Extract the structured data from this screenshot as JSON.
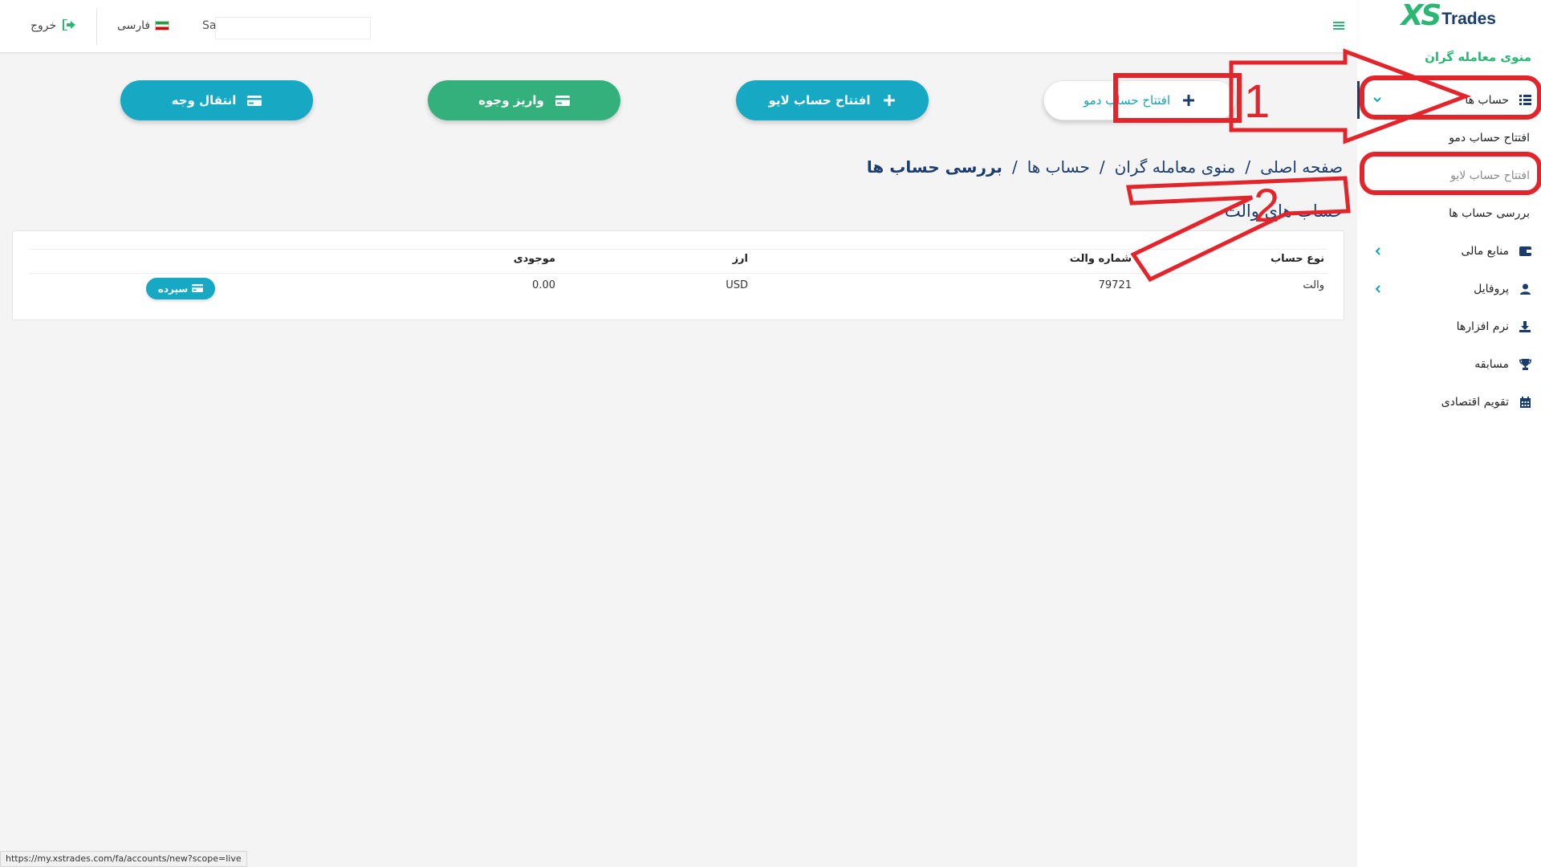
{
  "brand": {
    "xs": "XS",
    "trades": "Trades"
  },
  "sidebar": {
    "menu_title": "منوی معامله گران",
    "items": [
      {
        "label": "حساب ها",
        "icon": "list-icon",
        "active": true,
        "expanded": true
      },
      {
        "label": "منابع مالی",
        "icon": "wallet-icon",
        "has_children": true
      },
      {
        "label": "پروفایل",
        "icon": "user-icon",
        "has_children": true
      },
      {
        "label": "نرم افزارها",
        "icon": "download-icon"
      },
      {
        "label": "مسابقه",
        "icon": "trophy-icon"
      },
      {
        "label": "تقویم اقتصادی",
        "icon": "calendar-icon"
      }
    ],
    "subitems": [
      {
        "label": "افتتاح حساب دمو"
      },
      {
        "label": "افتتاح حساب لایو"
      },
      {
        "label": "بررسی حساب ها"
      }
    ]
  },
  "header": {
    "user": "Sa",
    "language": "فارسی",
    "logout": "خروج"
  },
  "actions": {
    "demo": "افتتاح حساب دمو",
    "live": "افتتاح حساب لایو",
    "deposit": "واریز وجوه",
    "transfer": "انتقال وجه"
  },
  "breadcrumb": {
    "home": "صفحه اصلی",
    "menu": "منوی معامله گران",
    "accounts": "حساب ها",
    "current": "بررسی حساب ها",
    "separator": "/"
  },
  "section_title": "حساب های والت",
  "table": {
    "headers": {
      "type": "نوع حساب",
      "wallet": "شماره والت",
      "currency": "ارز",
      "balance": "موجودی"
    },
    "rows": [
      {
        "type": "والت",
        "wallet": "79721",
        "currency": "USD",
        "balance": "0.00",
        "action": "سپرده"
      }
    ]
  },
  "annotations": {
    "one": "1",
    "two": "2",
    "color": "#e3242b"
  },
  "status_bar": {
    "url": "https://my.xstrades.com/fa/accounts/new?scope=live"
  },
  "colors": {
    "accent_green": "#2bb673",
    "accent_teal": "#17a8c4",
    "navy": "#1a3d6e"
  }
}
